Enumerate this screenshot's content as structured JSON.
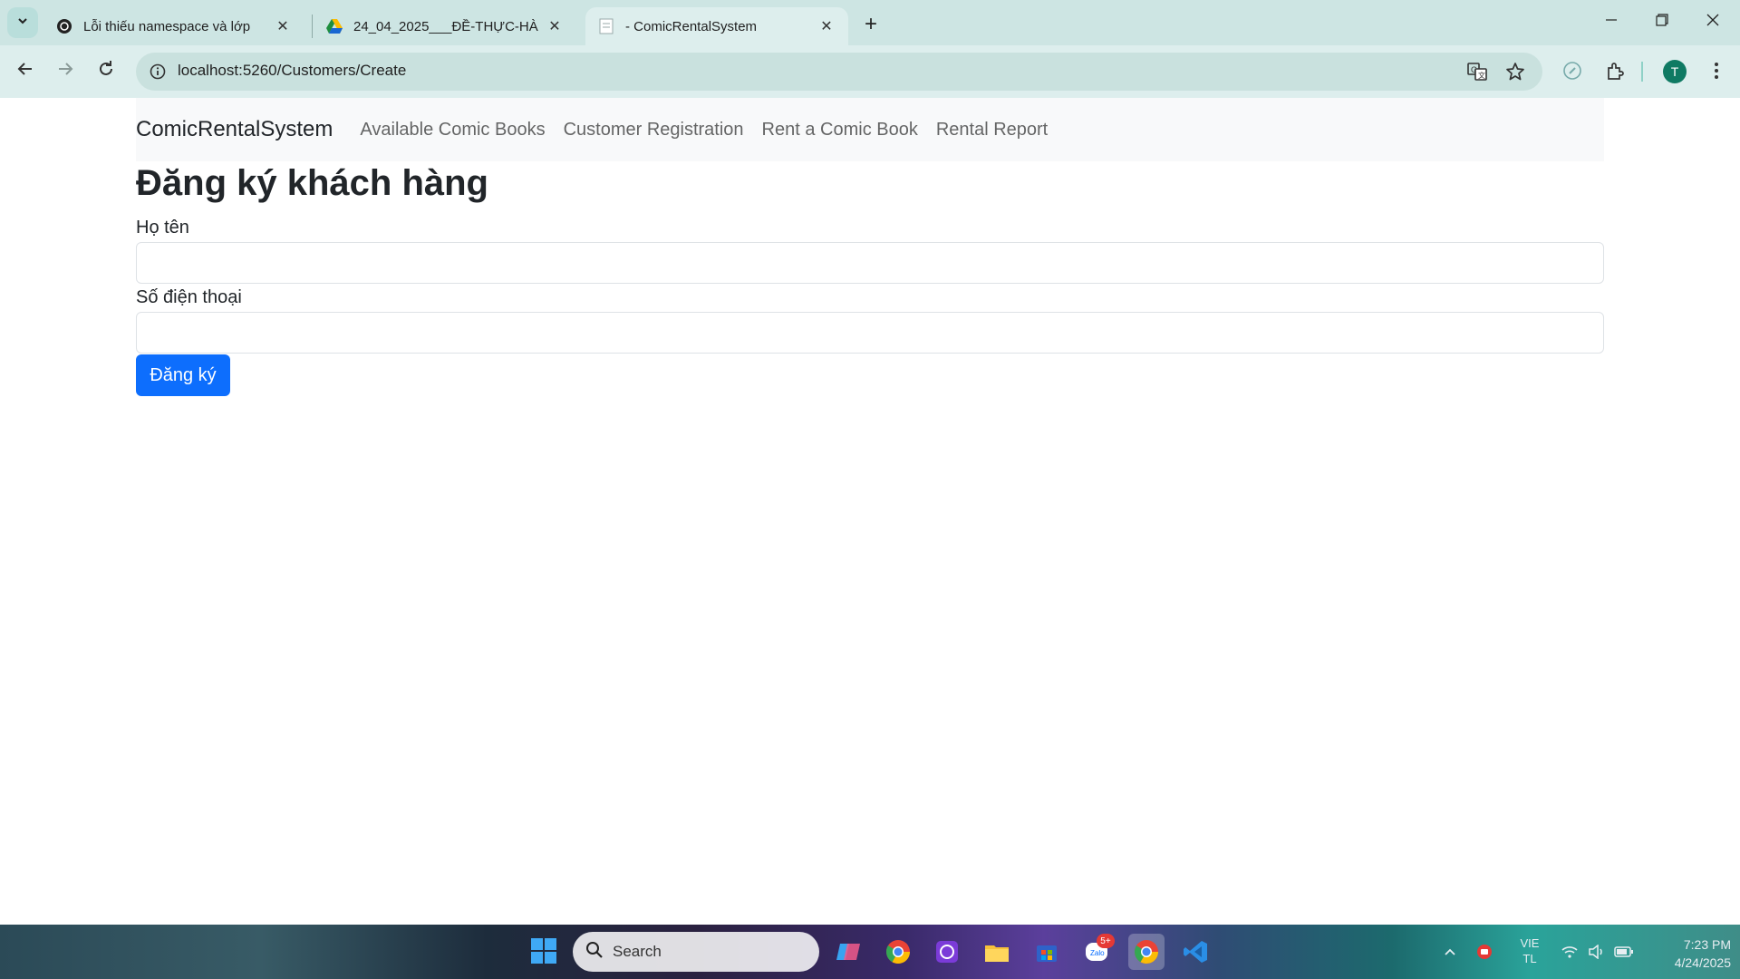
{
  "browser": {
    "tabs": [
      {
        "title": "Lỗi thiếu namespace và lớp",
        "icon": "openai-icon"
      },
      {
        "title": "24_04_2025___ĐỀ-THỰC-HÀNH",
        "icon": "google-drive-icon"
      },
      {
        "title": "- ComicRentalSystem",
        "icon": "page-icon",
        "active": true
      }
    ],
    "url": "localhost:5260/Customers/Create",
    "profile_initial": "T"
  },
  "site": {
    "brand": "ComicRentalSystem",
    "nav": [
      {
        "label": "Available Comic Books"
      },
      {
        "label": "Customer Registration"
      },
      {
        "label": "Rent a Comic Book"
      },
      {
        "label": "Rental Report"
      }
    ]
  },
  "form": {
    "heading": "Đăng ký khách hàng",
    "name_label": "Họ tên",
    "name_value": "",
    "phone_label": "Số điện thoại",
    "phone_value": "",
    "submit_label": "Đăng ký"
  },
  "taskbar": {
    "search_placeholder": "Search",
    "zalo_badge": "5+",
    "language": "VIE",
    "language_sub": "TL",
    "time": "7:23 PM",
    "date": "4/24/2025"
  },
  "colors": {
    "primary": "#0d6efd",
    "navbar_bg": "#f8f9fa",
    "chrome_frame": "#cde5e3"
  }
}
